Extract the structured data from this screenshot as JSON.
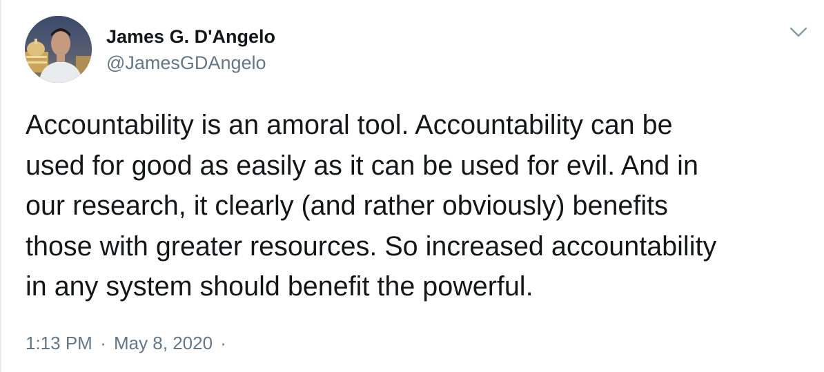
{
  "tweet": {
    "author": {
      "display_name": "James G. D'Angelo",
      "handle": "@JamesGDAngelo",
      "avatar_icon": "profile-photo"
    },
    "menu_icon": "chevron-down-icon",
    "text_lines": [
      "Accountability is an amoral tool. Accountability can be",
      "used for good as easily as it can be used for evil. And in",
      "our research, it clearly (and rather obviously) benefits",
      "those with greater resources. So increased accountability",
      "in any system should benefit the powerful."
    ],
    "time": "1:13 PM",
    "separator": "·",
    "date": "May 8, 2020",
    "trailing_separator": "·"
  },
  "colors": {
    "primary_text": "#14171a",
    "secondary_text": "#657786",
    "border": "#e6ecf0"
  }
}
